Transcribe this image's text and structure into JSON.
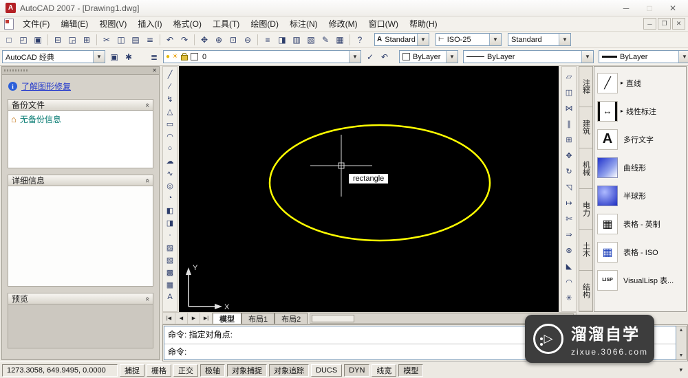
{
  "window": {
    "title": "AutoCAD 2007 - [Drawing1.dwg]",
    "minimize": "─",
    "maximize": "□",
    "close": "✕"
  },
  "menubar": {
    "items": [
      "文件(F)",
      "编辑(E)",
      "视图(V)",
      "插入(I)",
      "格式(O)",
      "工具(T)",
      "绘图(D)",
      "标注(N)",
      "修改(M)",
      "窗口(W)",
      "帮助(H)"
    ],
    "mdi_minimize": "─",
    "mdi_restore": "❐",
    "mdi_close": "✕"
  },
  "toolbar_standard": {
    "icons": [
      {
        "name": "qnew-button",
        "glyph": "□"
      },
      {
        "name": "open-button",
        "glyph": "◰"
      },
      {
        "name": "save-button",
        "glyph": "▣"
      },
      {
        "name": "toolbar-separator",
        "glyph": "",
        "cls": "sep"
      },
      {
        "name": "plot-button",
        "glyph": "⊟"
      },
      {
        "name": "plot-preview-button",
        "glyph": "◲"
      },
      {
        "name": "publish-button",
        "glyph": "⊞"
      },
      {
        "name": "toolbar-separator",
        "glyph": "",
        "cls": "sep"
      },
      {
        "name": "cut-button",
        "glyph": "✂"
      },
      {
        "name": "copy-clip-button",
        "glyph": "◫"
      },
      {
        "name": "paste-button",
        "glyph": "▤"
      },
      {
        "name": "match-properties-button",
        "glyph": "≌"
      },
      {
        "name": "toolbar-separator",
        "glyph": "",
        "cls": "sep"
      },
      {
        "name": "undo-button",
        "glyph": "↶"
      },
      {
        "name": "redo-button",
        "glyph": "↷"
      },
      {
        "name": "toolbar-separator",
        "glyph": "",
        "cls": "sep"
      },
      {
        "name": "pan-button",
        "glyph": "✥"
      },
      {
        "name": "zoom-realtime-button",
        "glyph": "⊕"
      },
      {
        "name": "zoom-window-button",
        "glyph": "⊡"
      },
      {
        "name": "zoom-previous-button",
        "glyph": "⊖"
      },
      {
        "name": "toolbar-separator",
        "glyph": "",
        "cls": "sep"
      },
      {
        "name": "properties-button",
        "glyph": "≡"
      },
      {
        "name": "designcenter-button",
        "glyph": "◨"
      },
      {
        "name": "tool-palettes-button",
        "glyph": "▥"
      },
      {
        "name": "sheetset-manager-button",
        "glyph": "▧"
      },
      {
        "name": "markup-manager-button",
        "glyph": "✎"
      },
      {
        "name": "quickcalc-button",
        "glyph": "▦"
      },
      {
        "name": "toolbar-separator",
        "glyph": "",
        "cls": "sep"
      },
      {
        "name": "help-button",
        "glyph": "?"
      }
    ],
    "text_style_icon": "A",
    "text_style": "Standard",
    "dim_style_icon": "⊢",
    "dim_style": "ISO-25",
    "table_style": "Standard",
    "dropdown_arrow": "▼"
  },
  "toolbar_properties": {
    "workspace": "AutoCAD 经典",
    "left_icons": [
      {
        "name": "workspace-save-button",
        "glyph": "▣"
      },
      {
        "name": "workspace-settings-button",
        "glyph": "✱"
      }
    ],
    "layer_left_icons": [
      {
        "name": "layer-properties-button",
        "glyph": "≣"
      }
    ],
    "layer_value": "0",
    "layer_right_icons": [
      {
        "name": "make-object-layer-current-button",
        "glyph": "✓"
      },
      {
        "name": "layer-previous-button",
        "glyph": "↶"
      }
    ],
    "color_value": "ByLayer",
    "linetype_value": "ByLayer",
    "lineweight_value": "ByLayer",
    "dropdown_arrow": "▼"
  },
  "recovery_palette": {
    "close": "✕",
    "info_icon": "i",
    "link": "了解图形修复",
    "collapse_glyph": "«",
    "sections": {
      "backup": "备份文件",
      "details": "详细信息",
      "preview": "预览"
    },
    "home_icon": "⌂",
    "backup_message": "无备份信息"
  },
  "draw_toolbar": {
    "tools": [
      {
        "name": "line-button",
        "glyph": "╱"
      },
      {
        "name": "construction-line-button",
        "glyph": "∕"
      },
      {
        "name": "polyline-button",
        "glyph": "↯"
      },
      {
        "name": "polygon-button",
        "glyph": "△"
      },
      {
        "name": "rectangle-button",
        "glyph": "▭"
      },
      {
        "name": "arc-button",
        "glyph": "◠"
      },
      {
        "name": "circle-button",
        "glyph": "○"
      },
      {
        "name": "revcloud-button",
        "glyph": "☁"
      },
      {
        "name": "spline-button",
        "glyph": "∿"
      },
      {
        "name": "ellipse-button",
        "glyph": "◎"
      },
      {
        "name": "ellipse-arc-button",
        "glyph": "◔"
      },
      {
        "name": "insert-block-button",
        "glyph": "◧"
      },
      {
        "name": "make-block-button",
        "glyph": "◨"
      },
      {
        "name": "point-button",
        "glyph": "∙"
      },
      {
        "name": "hatch-button",
        "glyph": "▨"
      },
      {
        "name": "gradient-button",
        "glyph": "▧"
      },
      {
        "name": "region-button",
        "glyph": "▩"
      },
      {
        "name": "table-button",
        "glyph": "▦"
      },
      {
        "name": "mtext-button",
        "glyph": "A"
      }
    ]
  },
  "modify_toolbar": {
    "tools": [
      {
        "name": "erase-button",
        "glyph": "▱"
      },
      {
        "name": "copy-button",
        "glyph": "◫"
      },
      {
        "name": "mirror-button",
        "glyph": "⋈"
      },
      {
        "name": "offset-button",
        "glyph": "∥"
      },
      {
        "name": "array-button",
        "glyph": "⊞"
      },
      {
        "name": "move-button",
        "glyph": "✥"
      },
      {
        "name": "rotate-button",
        "glyph": "↻"
      },
      {
        "name": "scale-button",
        "glyph": "◹"
      },
      {
        "name": "stretch-button",
        "glyph": "↦"
      },
      {
        "name": "trim-button",
        "glyph": "✄"
      },
      {
        "name": "extend-button",
        "glyph": "⇒"
      },
      {
        "name": "break-button",
        "glyph": "⊗"
      },
      {
        "name": "chamfer-button",
        "glyph": "◣"
      },
      {
        "name": "fillet-button",
        "glyph": "◠"
      },
      {
        "name": "explode-button",
        "glyph": "✳"
      }
    ]
  },
  "canvas": {
    "tooltip": "rectangle",
    "ucs_x": "X",
    "ucs_y": "Y"
  },
  "tool_palette": {
    "tabs": [
      "注释",
      "建筑",
      "机械",
      "电力",
      "土木",
      "结构"
    ],
    "items": [
      {
        "name": "palette-item-line",
        "label": "直线",
        "flyout": "▸",
        "icon": "╱",
        "cls": "i-line"
      },
      {
        "name": "palette-item-linear-dim",
        "label": "线性标注",
        "flyout": "▸",
        "icon": "↔",
        "cls": "i-dim"
      },
      {
        "name": "palette-item-mtext",
        "label": "多行文字",
        "flyout": "",
        "icon": "A",
        "cls": "i-text"
      },
      {
        "name": "palette-item-curve",
        "label": "曲线形",
        "flyout": "",
        "icon": "",
        "cls": "i-grad1"
      },
      {
        "name": "palette-item-hemisphere",
        "label": "半球形",
        "flyout": "",
        "icon": "",
        "cls": "i-grad2"
      },
      {
        "name": "palette-item-table-imperial",
        "label": "表格 - 英制",
        "flyout": "",
        "icon": "▦",
        "cls": "i-table"
      },
      {
        "name": "palette-item-table-iso",
        "label": "表格 - ISO",
        "flyout": "",
        "icon": "▦",
        "cls": "i-table-iso"
      },
      {
        "name": "palette-item-visuallisp",
        "label": "VisualLisp 表...",
        "flyout": "",
        "icon": "LISP",
        "cls": "i-lisp"
      }
    ]
  },
  "layout_tabs": {
    "nav": [
      "|◀",
      "◀",
      "▶",
      "▶|"
    ],
    "tabs": [
      {
        "label": "模型",
        "active": true
      },
      {
        "label": "布局1",
        "active": false
      },
      {
        "label": "布局2",
        "active": false
      }
    ]
  },
  "command": {
    "history": "命令: 指定对角点:",
    "prompt": "命令:",
    "scroll_up": "▲",
    "scroll_down": "▼"
  },
  "statusbar": {
    "coordinates": "1273.3058, 649.9495, 0.0000",
    "toggles": [
      {
        "name": "snap-toggle",
        "label": "捕捉",
        "active": false
      },
      {
        "name": "grid-toggle",
        "label": "栅格",
        "active": false
      },
      {
        "name": "ortho-toggle",
        "label": "正交",
        "active": false
      },
      {
        "name": "polar-toggle",
        "label": "极轴",
        "active": true
      },
      {
        "name": "osnap-toggle",
        "label": "对象捕捉",
        "active": true
      },
      {
        "name": "otrack-toggle",
        "label": "对象追踪",
        "active": true
      },
      {
        "name": "ducs-toggle",
        "label": "DUCS",
        "active": false
      },
      {
        "name": "dyn-toggle",
        "label": "DYN",
        "active": true
      },
      {
        "name": "lineweight-toggle",
        "label": "线宽",
        "active": false
      },
      {
        "name": "model-toggle",
        "label": "模型",
        "active": true
      }
    ],
    "menu_arrow": "▾"
  },
  "watermark": {
    "logo_glyph": "▷",
    "brand": "溜溜自学",
    "site": "zixue.3066.com"
  },
  "colors": {
    "ellipse": "#ffff00",
    "canvas": "#000000",
    "link": "#1f35cc",
    "backup_text": "#0a7d74"
  }
}
